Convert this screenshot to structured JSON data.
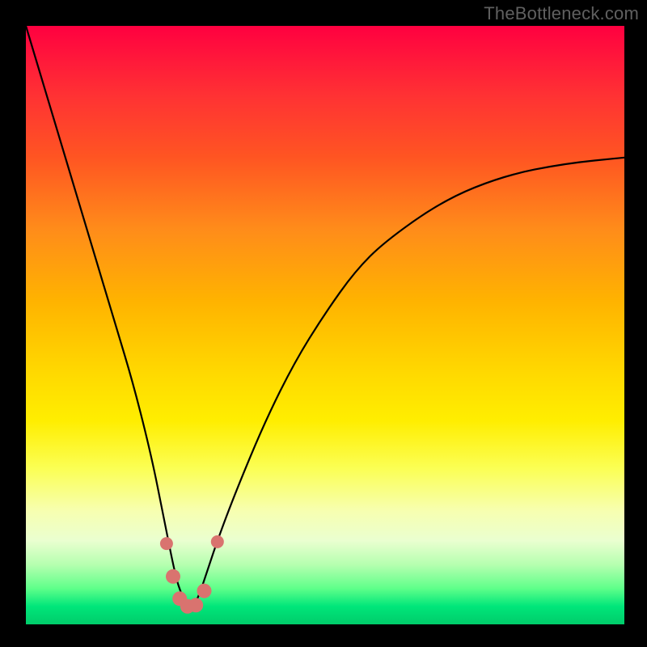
{
  "attribution": "TheBottleneck.com",
  "colors": {
    "background": "#000000",
    "gradient_top": "#ff0040",
    "gradient_bottom": "#00cc6a",
    "dot_fill": "#d9736f",
    "curve_stroke": "#000000"
  },
  "chart_data": {
    "type": "line",
    "title": "",
    "xlabel": "",
    "ylabel": "",
    "xlim": [
      0,
      100
    ],
    "ylim": [
      0,
      100
    ],
    "notes": "V-shaped bottleneck curve; minimum near x≈27, y≈3; color gradient implies worse (red) at top, better (green) at bottom",
    "series": [
      {
        "name": "bottleneck-curve",
        "x": [
          0,
          3,
          6,
          9,
          12,
          15,
          18,
          21,
          23,
          25,
          26,
          27,
          28,
          29,
          30,
          32,
          35,
          40,
          45,
          50,
          55,
          60,
          70,
          80,
          90,
          100
        ],
        "y": [
          100,
          90,
          80,
          70,
          60,
          50,
          40,
          28,
          18,
          8,
          5,
          3,
          3,
          5,
          8,
          14,
          22,
          34,
          44,
          52,
          59,
          64,
          71,
          75,
          77,
          78
        ]
      }
    ],
    "markers": [
      {
        "name": "dot-left-upper",
        "x": 23.5,
        "y": 13.5
      },
      {
        "name": "dot-left-mid",
        "x": 24.6,
        "y": 8.0
      },
      {
        "name": "dot-left-low",
        "x": 25.7,
        "y": 4.3
      },
      {
        "name": "dot-min-1",
        "x": 27.0,
        "y": 3.0
      },
      {
        "name": "dot-min-2",
        "x": 28.4,
        "y": 3.2
      },
      {
        "name": "dot-right-low",
        "x": 29.8,
        "y": 5.6
      },
      {
        "name": "dot-right-upper",
        "x": 32.0,
        "y": 13.8
      }
    ]
  }
}
